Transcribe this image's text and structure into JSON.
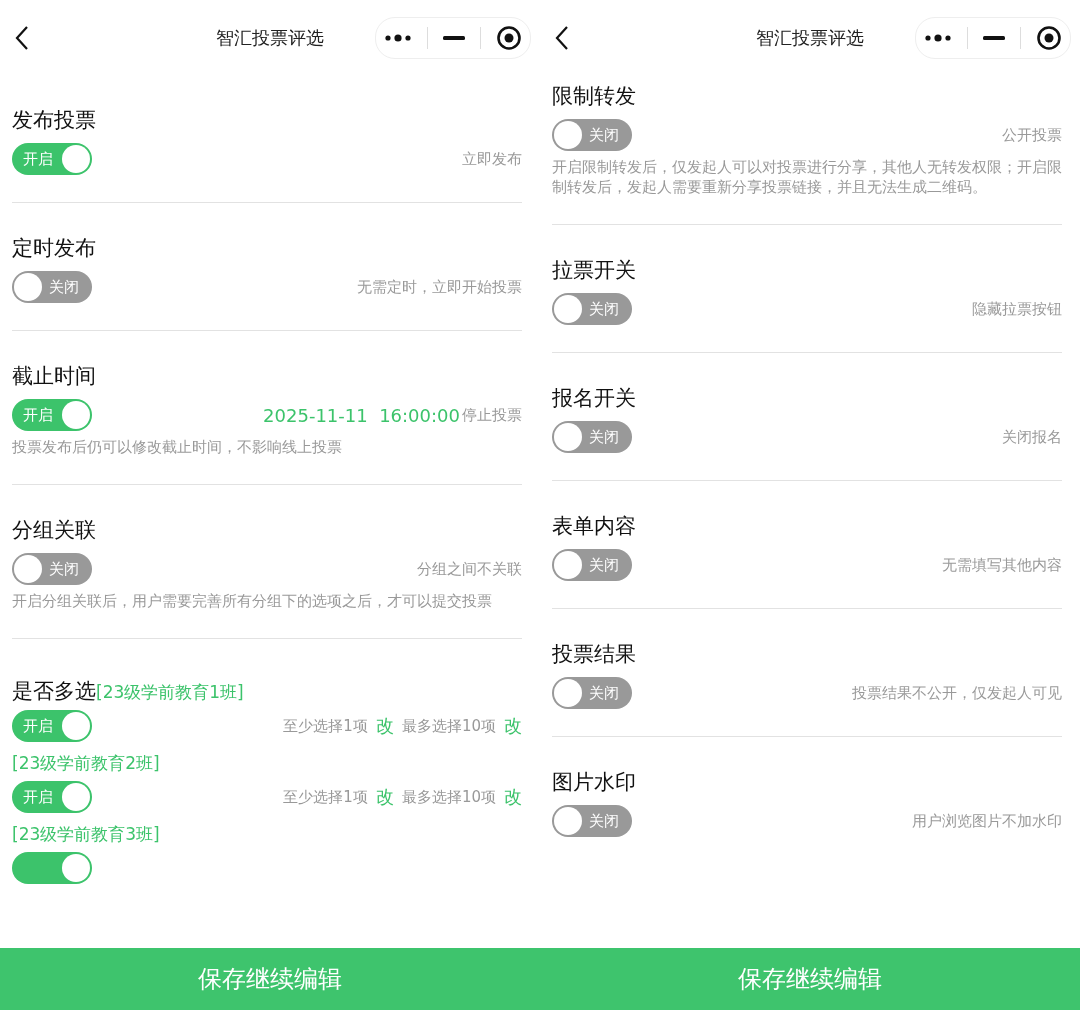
{
  "screens": [
    {
      "title": "智汇投票评选",
      "settings": [
        {
          "title": "发布投票",
          "switch": {
            "on": true,
            "label": "开启"
          },
          "note": "立即发布"
        },
        {
          "title": "定时发布",
          "switch": {
            "on": false,
            "label": "关闭"
          },
          "note": "无需定时，立即开始投票"
        },
        {
          "title": "截止时间",
          "switch": {
            "on": true,
            "label": "开启"
          },
          "note_value": "2025-11-11  16:00:00",
          "note": "停止投票",
          "hint": "投票发布后仍可以修改截止时间，不影响线上投票"
        },
        {
          "title": "分组关联",
          "switch": {
            "on": false,
            "label": "关闭"
          },
          "note": "分组之间不关联",
          "hint": "开启分组关联后，用户需要完善所有分组下的选项之后，才可以提交投票"
        },
        {
          "title": "是否多选",
          "groups": [
            {
              "label": "[23级学前教育1班]",
              "switch": {
                "on": true,
                "label": "开启"
              },
              "min": "至少选择1项",
              "min_edit": "改",
              "max": "最多选择10项",
              "max_edit": "改"
            },
            {
              "label": "[23级学前教育2班]",
              "switch": {
                "on": true,
                "label": "开启"
              },
              "min": "至少选择1项",
              "min_edit": "改",
              "max": "最多选择10项",
              "max_edit": "改"
            },
            {
              "label": "[23级学前教育3班]",
              "switch": {
                "on": true
              }
            }
          ]
        }
      ],
      "save_button": "保存继续编辑"
    },
    {
      "title": "智汇投票评选",
      "settings": [
        {
          "title": "限制转发",
          "switch": {
            "on": false,
            "label": "关闭"
          },
          "note": "公开投票",
          "hint": "开启限制转发后，仅发起人可以对投票进行分享，其他人无转发权限；开启限制转发后，发起人需要重新分享投票链接，并且无法生成二维码。"
        },
        {
          "title": "拉票开关",
          "switch": {
            "on": false,
            "label": "关闭"
          },
          "note": "隐藏拉票按钮"
        },
        {
          "title": "报名开关",
          "switch": {
            "on": false,
            "label": "关闭"
          },
          "note": "关闭报名"
        },
        {
          "title": "表单内容",
          "switch": {
            "on": false,
            "label": "关闭"
          },
          "note": "无需填写其他内容"
        },
        {
          "title": "投票结果",
          "switch": {
            "on": false,
            "label": "关闭"
          },
          "note": "投票结果不公开，仅发起人可见"
        },
        {
          "title": "图片水印",
          "switch": {
            "on": false,
            "label": "关闭"
          },
          "note": "用户浏览图片不加水印"
        }
      ],
      "save_button": "保存继续编辑"
    }
  ]
}
